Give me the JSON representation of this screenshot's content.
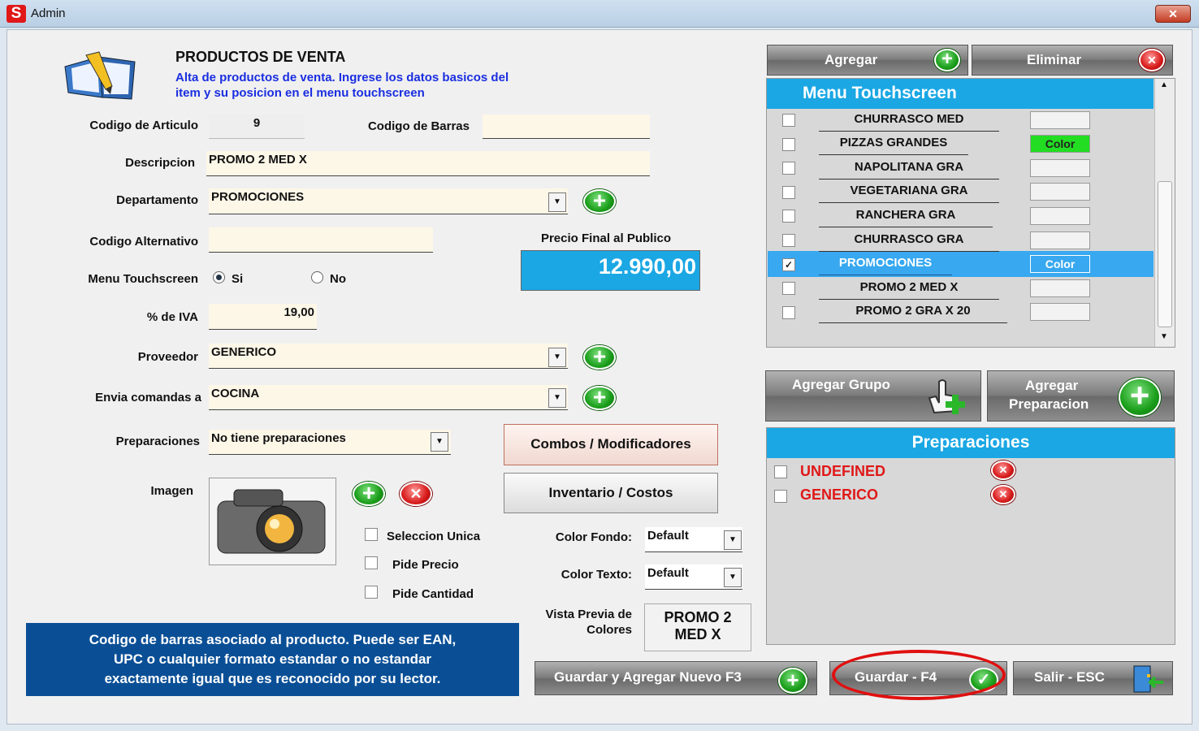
{
  "window": {
    "title": "Admin",
    "logo_letter": "S",
    "close_symbol": "✕"
  },
  "header": {
    "title": "PRODUCTOS DE VENTA",
    "subtitle_line1": "Alta de productos de venta. Ingrese los datos basicos del",
    "subtitle_line2": "item y su posicion en el menu touchscreen"
  },
  "form": {
    "codigo_articulo": {
      "label": "Codigo de Articulo",
      "value": "9"
    },
    "codigo_barras": {
      "label": "Codigo de Barras",
      "value": ""
    },
    "descripcion": {
      "label": "Descripcion",
      "value": "PROMO 2 MED X"
    },
    "departamento": {
      "label": "Departamento",
      "value": "PROMOCIONES"
    },
    "codigo_alternativo": {
      "label": "Codigo Alternativo",
      "value": ""
    },
    "precio": {
      "label": "Precio Final al Publico",
      "value": "12.990,00"
    },
    "menu_touchscreen": {
      "label": "Menu Touchscreen",
      "opt_si": "Si",
      "opt_no": "No"
    },
    "iva": {
      "label": "% de IVA",
      "value": "19,00"
    },
    "proveedor": {
      "label": "Proveedor",
      "value": "GENERICO"
    },
    "envia_comandas": {
      "label": "Envia comandas a",
      "value": "COCINA"
    },
    "preparaciones": {
      "label": "Preparaciones",
      "value": "No tiene preparaciones"
    },
    "imagen": {
      "label": "Imagen"
    },
    "checks": {
      "seleccion_unica": "Seleccion Unica",
      "pide_precio": "Pide Precio",
      "pide_cantidad": "Pide Cantidad"
    },
    "color_fondo": {
      "label": "Color Fondo:",
      "value": "Default"
    },
    "color_texto": {
      "label": "Color Texto:",
      "value": "Default"
    },
    "vista_previa": {
      "label_line1": "Vista Previa de",
      "label_line2": "Colores",
      "line1": "PROMO 2",
      "line2": "MED X"
    }
  },
  "buttons": {
    "combos": "Combos /  Modificadores",
    "inventario": "Inventario / Costos",
    "agregar": "Agregar",
    "eliminar": "Eliminar",
    "agregar_grupo": "Agregar Grupo",
    "agregar_preparacion_1": "Agregar",
    "agregar_preparacion_2": "Preparacion",
    "guardar_nuevo": "Guardar y Agregar Nuevo F3",
    "guardar": "Guardar - F4",
    "salir": "Salir - ESC"
  },
  "menu_touchscreen": {
    "title": "Menu Touchscreen",
    "color_text": "Color",
    "items": [
      {
        "label": "CHURRASCO MED",
        "checked": false,
        "color": ""
      },
      {
        "label": "PIZZAS GRANDES",
        "checked": false,
        "color": "Color"
      },
      {
        "label": "NAPOLITANA GRA",
        "checked": false,
        "color": ""
      },
      {
        "label": "VEGETARIANA GRA",
        "checked": false,
        "color": ""
      },
      {
        "label": "RANCHERA GRA",
        "checked": false,
        "color": ""
      },
      {
        "label": "CHURRASCO GRA",
        "checked": false,
        "color": ""
      },
      {
        "label": "PROMOCIONES",
        "checked": true,
        "color": "Color"
      },
      {
        "label": "PROMO 2 MED X",
        "checked": false,
        "color": ""
      },
      {
        "label": "PROMO 2 GRA X 20",
        "checked": false,
        "color": ""
      }
    ]
  },
  "preparaciones_panel": {
    "title": "Preparaciones",
    "items": [
      {
        "label": "UNDEFINED"
      },
      {
        "label": "GENERICO"
      }
    ]
  },
  "help": {
    "line1": "Codigo de barras asociado al producto. Puede ser EAN,",
    "line2": "UPC o cualquier formato estandar o no estandar",
    "line3": "exactamente igual que es reconocido por su lector."
  },
  "colors": {
    "accent_blue": "#1aa7e4",
    "selected_row": "#38a8f0",
    "pizzas_color": "#22dd22",
    "help_bg": "#0a4f96"
  }
}
